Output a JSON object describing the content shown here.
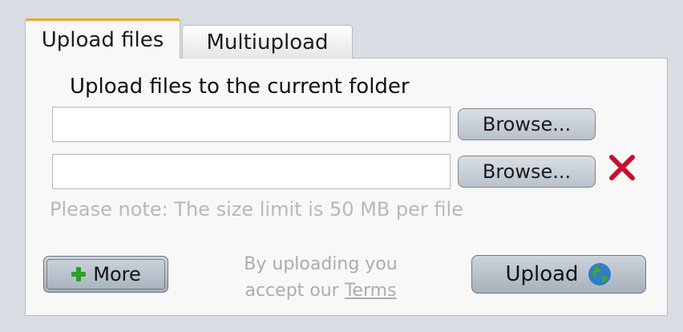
{
  "tabs": [
    {
      "label": "Upload files",
      "active": true
    },
    {
      "label": "Multiupload",
      "active": false
    }
  ],
  "panel": {
    "heading": "Upload files to the current folder",
    "file_inputs": [
      {
        "value": "",
        "browse_label": "Browse..."
      },
      {
        "value": "",
        "browse_label": "Browse..."
      }
    ],
    "note": "Please note: The size limit is 50 MB per file",
    "more_label": "More",
    "terms_line1": "By uploading you",
    "terms_line2_prefix": "accept our ",
    "terms_link": "Terms",
    "upload_label": "Upload"
  },
  "colors": {
    "tab_accent": "#f0a424",
    "remove_icon": "#c8102e",
    "plus_icon": "#2e9e2a",
    "note_text": "#b5b9bd"
  },
  "icons": {
    "remove": "close-x-icon",
    "more": "plus-icon",
    "upload": "globe-icon"
  }
}
